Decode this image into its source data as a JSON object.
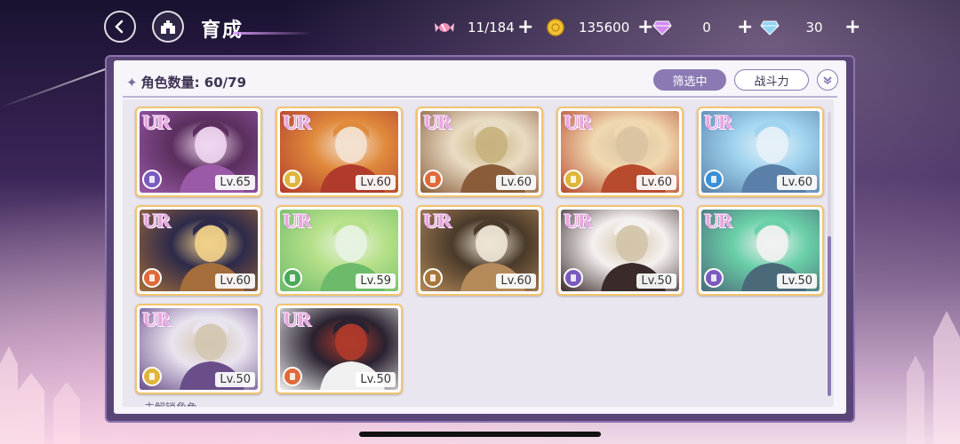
{
  "header": {
    "title": "育成",
    "resources": [
      {
        "icon": "candy-icon",
        "value": "11/184"
      },
      {
        "icon": "gold-coin-icon",
        "value": "135600"
      },
      {
        "icon": "purple-gem-icon",
        "value": "0"
      },
      {
        "icon": "blue-diamond-icon",
        "value": "30"
      }
    ],
    "plus": "+"
  },
  "panel": {
    "count_label": "角色数量: 60/79",
    "filter_label": "筛选中",
    "sort_label": "战斗力",
    "footer_peek": "未解锁角色"
  },
  "colors": {
    "accent": "#8a79b3",
    "frame": "#5a4577",
    "card_border": "#f3c46e"
  },
  "cards": [
    {
      "rarity": "UR",
      "level": "Lv.65",
      "role_color": "#7b5bbf",
      "art": [
        "#5b2f5e",
        "#9a5aa8",
        "#f0d6ef"
      ]
    },
    {
      "rarity": "UR",
      "level": "Lv.60",
      "role_color": "#e0b63a",
      "art": [
        "#e08a3c",
        "#b03b2b",
        "#f3e2d1"
      ]
    },
    {
      "rarity": "UR",
      "level": "Lv.60",
      "role_color": "#e06a3a",
      "art": [
        "#e9dcc4",
        "#8a5c3a",
        "#c8b27e"
      ]
    },
    {
      "rarity": "UR",
      "level": "Lv.60",
      "role_color": "#e0b63a",
      "art": [
        "#f0d8b0",
        "#b84a2e",
        "#d9c3a1"
      ]
    },
    {
      "rarity": "UR",
      "level": "Lv.60",
      "role_color": "#3a8fd6",
      "art": [
        "#9fd3ef",
        "#5a7fa8",
        "#e7f1f7"
      ]
    },
    {
      "rarity": "UR",
      "level": "Lv.60",
      "role_color": "#e06a3a",
      "art": [
        "#2d2a4a",
        "#a46d3b",
        "#f2d28a"
      ]
    },
    {
      "rarity": "UR",
      "level": "Lv.59",
      "role_color": "#4aa85a",
      "art": [
        "#b7e08a",
        "#6dbb6a",
        "#e8f3e3"
      ]
    },
    {
      "rarity": "UR",
      "level": "Lv.60",
      "role_color": "#a6763a",
      "art": [
        "#4a3a2a",
        "#b48a5a",
        "#f0e6d6"
      ]
    },
    {
      "rarity": "UR",
      "level": "Lv.50",
      "role_color": "#7b5bbf",
      "art": [
        "#f5f1f0",
        "#3a2a2a",
        "#d2c4a8"
      ]
    },
    {
      "rarity": "UR",
      "level": "Lv.50",
      "role_color": "#7b5bbf",
      "art": [
        "#6ad0a8",
        "#4a6a7a",
        "#f2f2f2"
      ]
    },
    {
      "rarity": "UR",
      "level": "Lv.50",
      "role_color": "#e0b63a",
      "art": [
        "#e9e4ef",
        "#6a4e8a",
        "#d4c6b0"
      ]
    },
    {
      "rarity": "UR",
      "level": "Lv.50",
      "role_color": "#e06a3a",
      "art": [
        "#2a2230",
        "#f0f0f0",
        "#b03b2b"
      ]
    }
  ]
}
